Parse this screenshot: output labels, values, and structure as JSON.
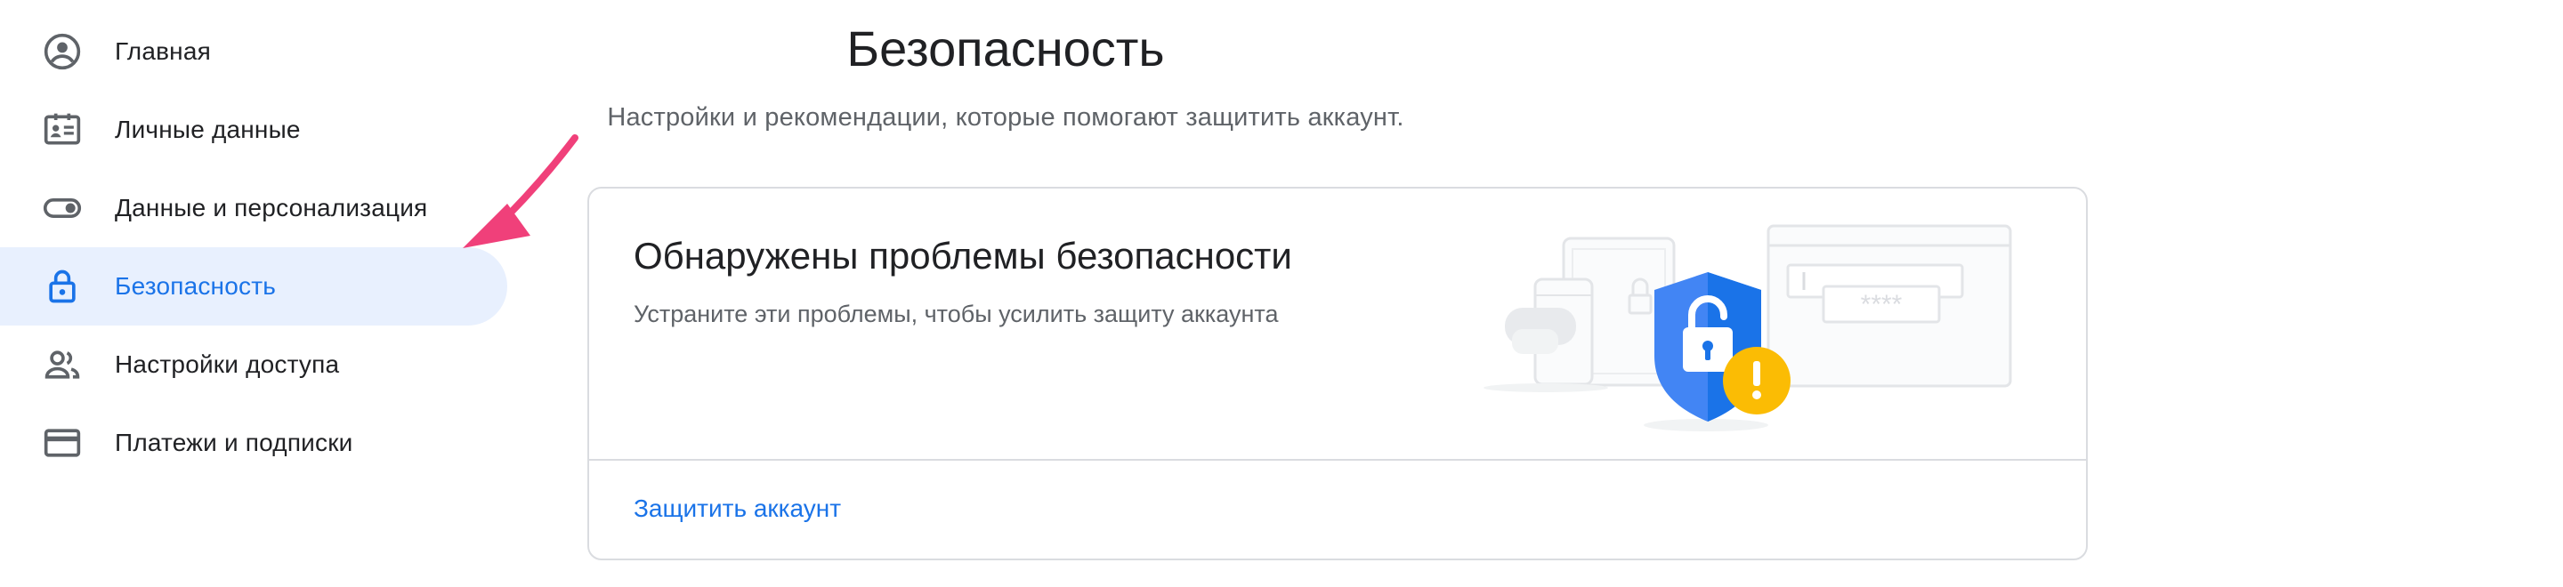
{
  "sidebar": {
    "items": [
      {
        "label": "Главная",
        "icon": "account-circle-icon",
        "active": false
      },
      {
        "label": "Личные данные",
        "icon": "id-card-icon",
        "active": false
      },
      {
        "label": "Данные и персонализация",
        "icon": "toggle-icon",
        "active": false
      },
      {
        "label": "Безопасность",
        "icon": "lock-icon",
        "active": true
      },
      {
        "label": "Настройки доступа",
        "icon": "people-icon",
        "active": false
      },
      {
        "label": "Платежи и подписки",
        "icon": "credit-card-icon",
        "active": false
      }
    ]
  },
  "header": {
    "title": "Безопасность",
    "subtitle": "Настройки и рекомендации, которые помогают защитить аккаунт."
  },
  "card": {
    "title": "Обнаружены проблемы безопасности",
    "description": "Устраните эти проблемы, чтобы усилить защиту аккаунта",
    "action_label": "Защитить аккаунт",
    "password_mask": "****"
  },
  "colors": {
    "accent": "#1a73e8",
    "active_bg": "#e8f0fe",
    "arrow": "#f0407a",
    "shield": "#4285f4",
    "warning": "#fbbc04"
  }
}
